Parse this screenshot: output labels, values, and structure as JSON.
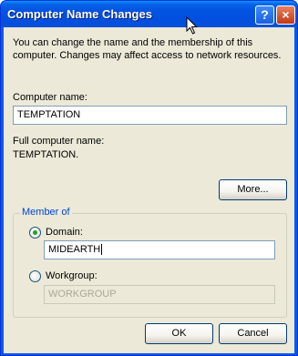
{
  "window": {
    "title": "Computer Name Changes",
    "help_label": "?",
    "close_label": "×"
  },
  "description": "You can change the name and the membership of this computer. Changes may affect access to network resources.",
  "computer_name": {
    "label": "Computer name:",
    "value": "TEMPTATION"
  },
  "full_name": {
    "label": "Full computer name:",
    "value": "TEMPTATION."
  },
  "more_button": "More...",
  "member_of": {
    "legend": "Member of",
    "domain_label": "Domain:",
    "domain_value": "MIDEARTH",
    "domain_selected": true,
    "workgroup_label": "Workgroup:",
    "workgroup_value": "WORKGROUP"
  },
  "buttons": {
    "ok": "OK",
    "cancel": "Cancel"
  },
  "colors": {
    "title_bar": "#0352e0",
    "dialog_face": "#ece9d8",
    "group_legend": "#0046d5",
    "radio_dot": "#21a121"
  }
}
